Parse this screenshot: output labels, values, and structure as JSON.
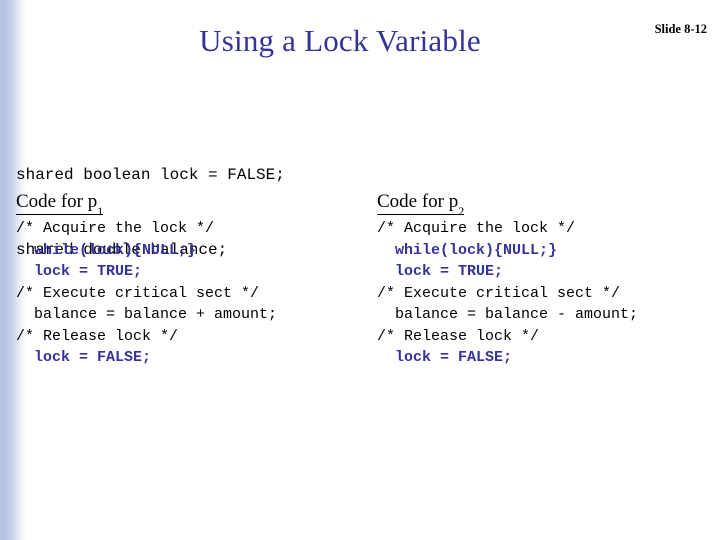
{
  "slide": {
    "title": "Using a Lock Variable",
    "slide_number": "Slide 8-12",
    "title_color": "#333399",
    "code_accent_color": "#333399",
    "text_color": "#000000",
    "background_color": "#ffffff",
    "edge_stripe_color": "#b4c1e0"
  },
  "shared_declarations": {
    "line1": "shared boolean lock = FALSE;",
    "line2": "shared double balance;"
  },
  "columns": [
    {
      "heading_text": "Code for p",
      "heading_subscript": "1",
      "lines": [
        {
          "text": "/* Acquire the lock */",
          "style": "comment"
        },
        {
          "text": "  while(lock){NULL;}",
          "style": "stmt"
        },
        {
          "text": "  lock = TRUE;",
          "style": "stmt"
        },
        {
          "text": "/* Execute critical sect */",
          "style": "comment"
        },
        {
          "text": "  balance = balance + amount;",
          "style": "plain"
        },
        {
          "text": "/* Release lock */",
          "style": "comment"
        },
        {
          "text": "  lock = FALSE;",
          "style": "stmt"
        }
      ]
    },
    {
      "heading_text": "Code for p",
      "heading_subscript": "2",
      "lines": [
        {
          "text": "/* Acquire the lock */",
          "style": "comment"
        },
        {
          "text": "  while(lock){NULL;}",
          "style": "stmt"
        },
        {
          "text": "  lock = TRUE;",
          "style": "stmt"
        },
        {
          "text": "/* Execute critical sect */",
          "style": "comment"
        },
        {
          "text": "  balance = balance - amount;",
          "style": "plain"
        },
        {
          "text": "/* Release lock */",
          "style": "comment"
        },
        {
          "text": "  lock = FALSE;",
          "style": "stmt"
        }
      ]
    }
  ]
}
